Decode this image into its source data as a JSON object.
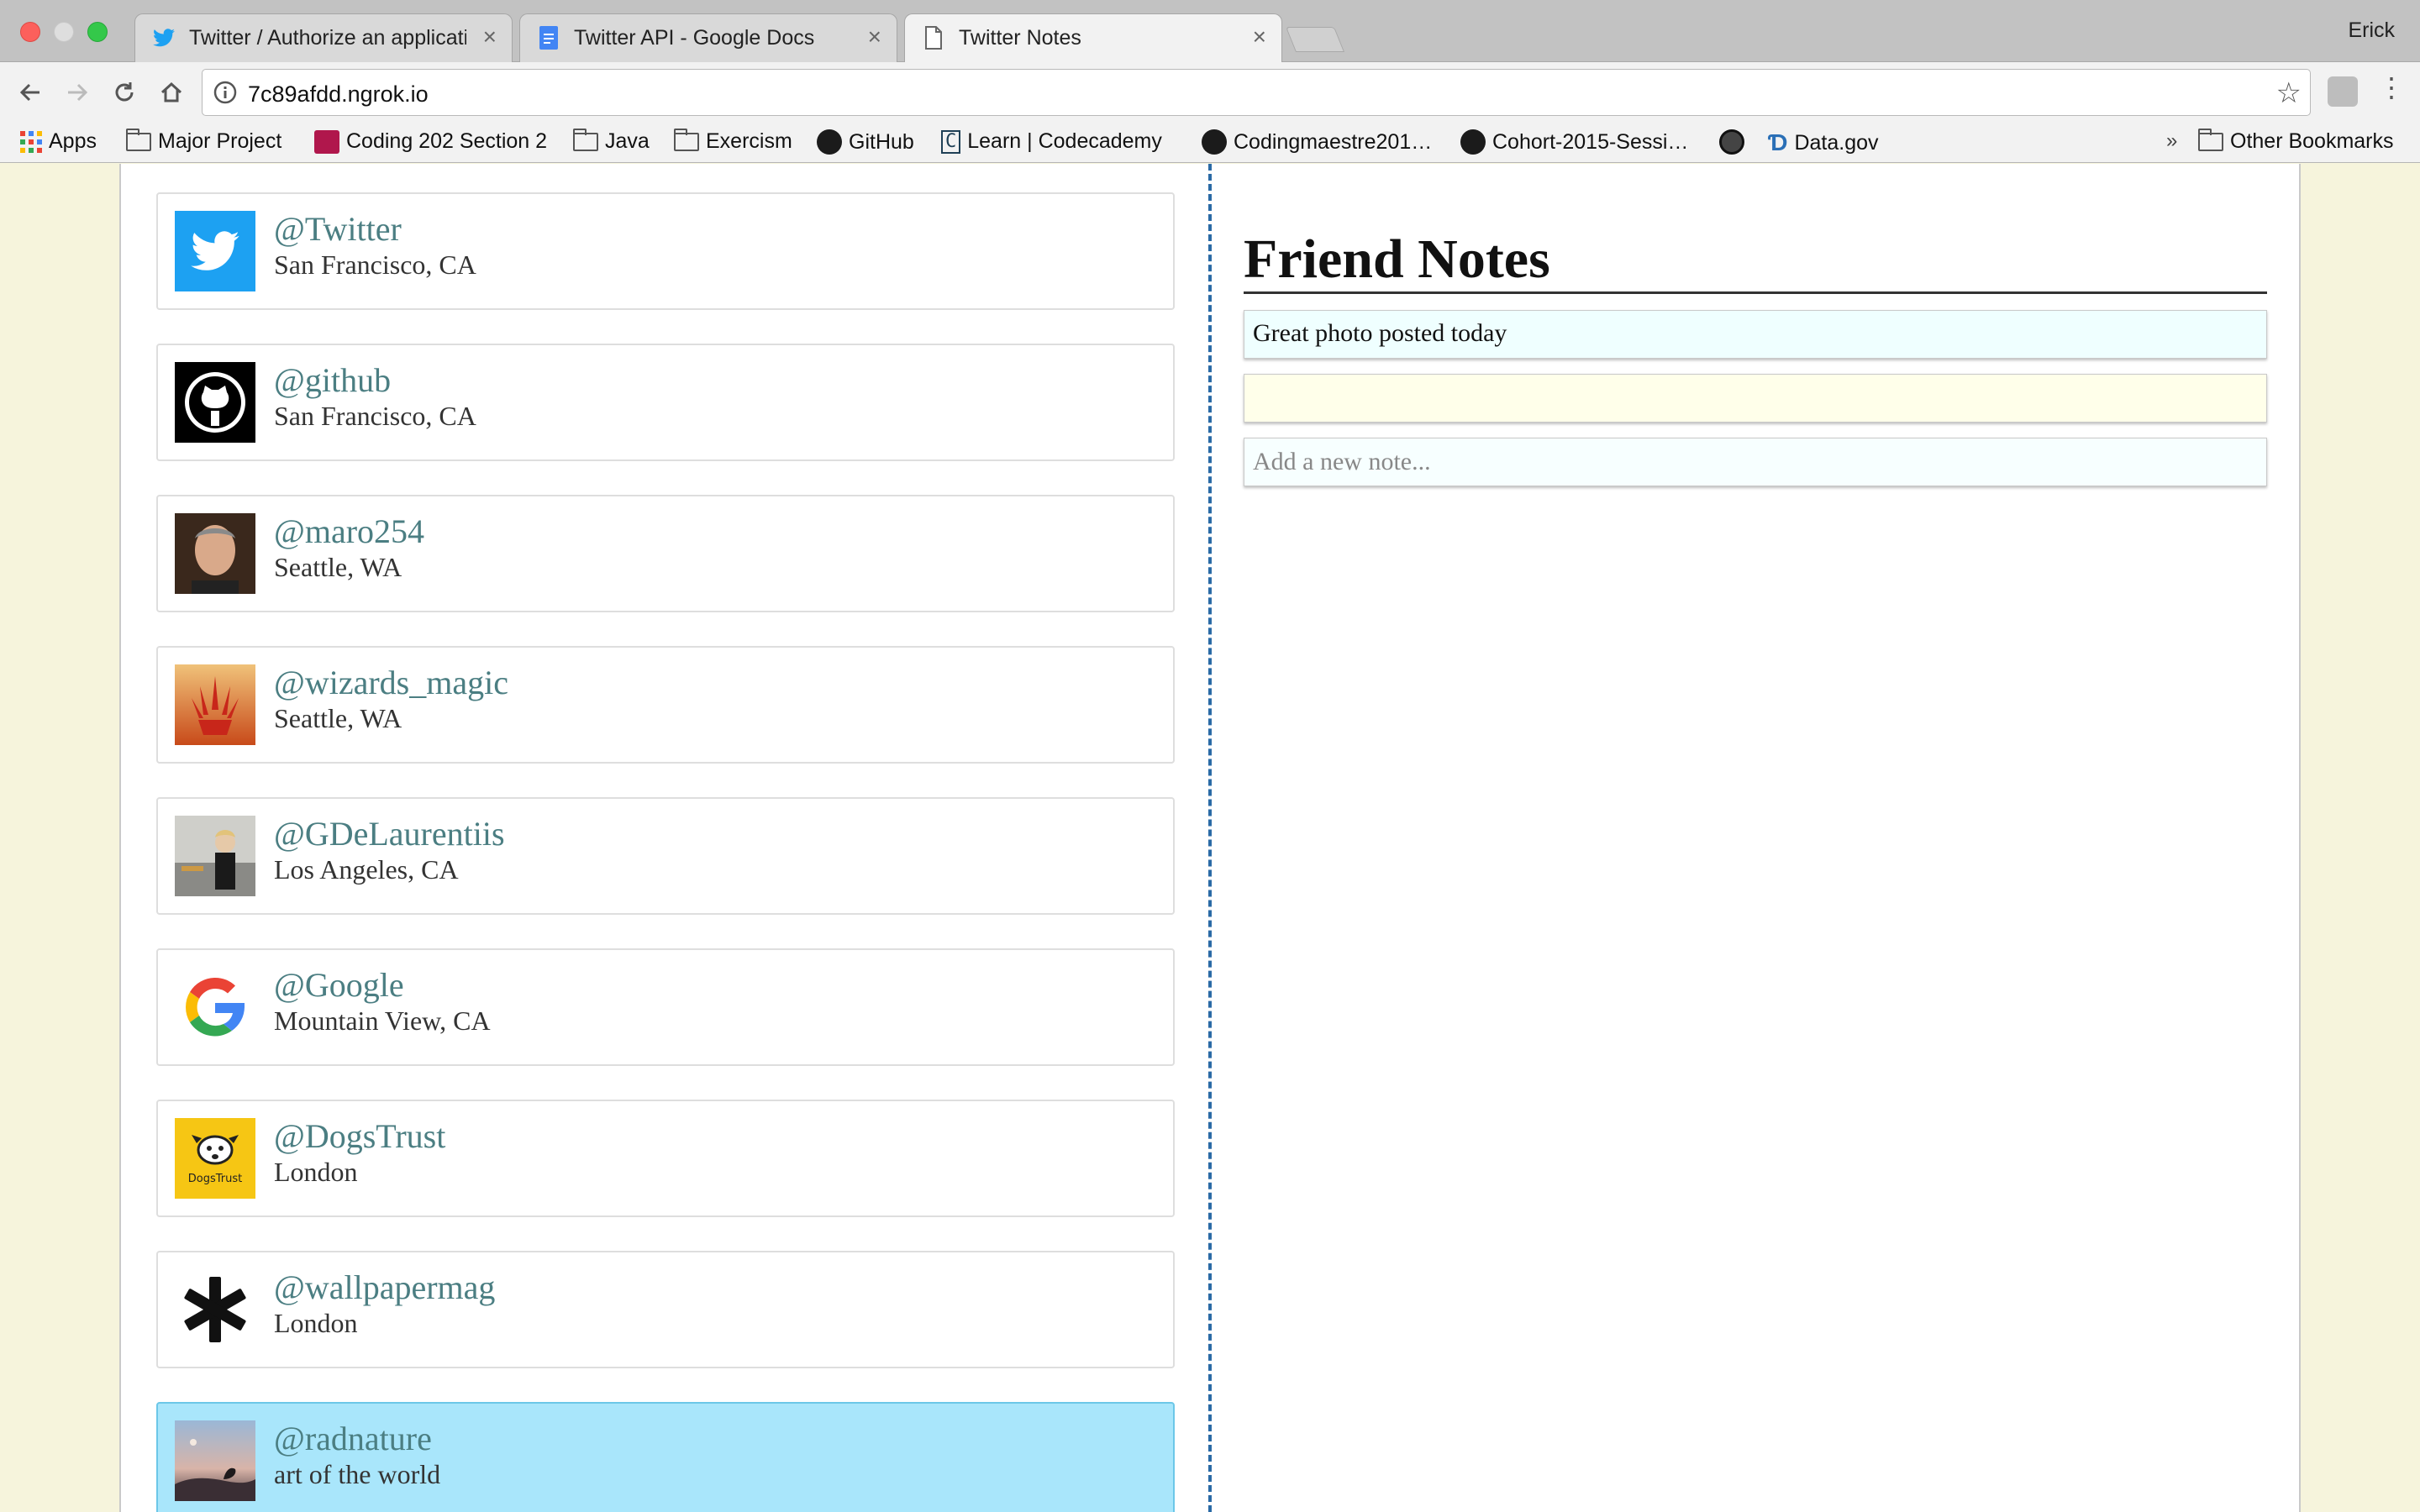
{
  "browser": {
    "tabs": [
      {
        "title": "Twitter / Authorize an applicati",
        "icon": "twitter-bird-icon",
        "active": false
      },
      {
        "title": "Twitter API - Google Docs",
        "icon": "google-docs-icon",
        "active": false
      },
      {
        "title": "Twitter Notes",
        "icon": "document-icon",
        "active": true
      }
    ],
    "tab_close_glyph": "×",
    "profile_name": "Erick",
    "url": "7c89afdd.ngrok.io",
    "bookmarks": [
      {
        "label": "Apps",
        "icon": "apps-grid-icon"
      },
      {
        "label": "Major Project",
        "icon": "folder-icon"
      },
      {
        "label": "Coding 202 Section 2",
        "icon": "profile-badge-icon"
      },
      {
        "label": "Java",
        "icon": "folder-icon"
      },
      {
        "label": "Exercism",
        "icon": "folder-icon"
      },
      {
        "label": "GitHub",
        "icon": "github-icon"
      },
      {
        "label": "Learn | Codecademy",
        "icon": "codecademy-icon"
      },
      {
        "label": "Codingmaestre201…",
        "icon": "github-icon"
      },
      {
        "label": "Cohort-2015-Sessi…",
        "icon": "github-icon"
      },
      {
        "label": "",
        "icon": "github-circle-icon"
      },
      {
        "label": "Data.gov",
        "icon": "datagov-icon"
      }
    ],
    "bookmarks_overflow": "»",
    "other_bookmarks": "Other Bookmarks"
  },
  "friends": [
    {
      "handle": "@Twitter",
      "location": "San Francisco, CA",
      "avatar": "twitter-bird-avatar",
      "selected": false
    },
    {
      "handle": "@github",
      "location": "San Francisco, CA",
      "avatar": "github-octocat-avatar",
      "selected": false
    },
    {
      "handle": "@maro254",
      "location": "Seattle, WA",
      "avatar": "person-portrait-avatar",
      "selected": false
    },
    {
      "handle": "@wizards_magic",
      "location": "Seattle, WA",
      "avatar": "magic-planeswalker-avatar",
      "selected": false
    },
    {
      "handle": "@GDeLaurentiis",
      "location": "Los Angeles, CA",
      "avatar": "person-kitchen-avatar",
      "selected": false
    },
    {
      "handle": "@Google",
      "location": "Mountain View, CA",
      "avatar": "google-g-avatar",
      "selected": false
    },
    {
      "handle": "@DogsTrust",
      "location": "London",
      "avatar": "dogs-trust-avatar",
      "selected": false
    },
    {
      "handle": "@wallpapermag",
      "location": "London",
      "avatar": "asterisk-avatar",
      "selected": false
    },
    {
      "handle": "@radnature",
      "location": "art of the world",
      "avatar": "nature-landscape-avatar",
      "selected": true
    }
  ],
  "notes": {
    "title": "Friend Notes",
    "items": [
      "Great photo posted today",
      ""
    ],
    "new_note_placeholder": "Add a new note..."
  },
  "colors": {
    "handle_text": "#4b7e82",
    "selected_card": "#a9e6fb",
    "divider": "#2a6aa6",
    "page_background": "#f6f4dc"
  }
}
